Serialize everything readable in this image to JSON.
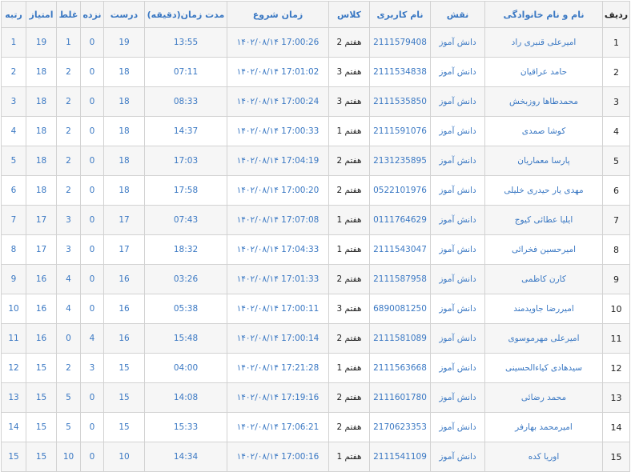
{
  "headers": {
    "radif": "ردیف",
    "name": "نام و نام خانوادگی",
    "role": "نقش",
    "username": "نام کاربری",
    "class": "کلاس",
    "start": "زمان شروع",
    "duration": "مدت زمان(دقیقه)",
    "correct": "درست",
    "unanswered": "نزده",
    "wrong": "غلط",
    "score": "امتیاز",
    "rank": "رتبه"
  },
  "rows": [
    {
      "radif": "1",
      "name": "امیرعلی قنبری راد",
      "role": "دانش آموز",
      "username": "2111579408",
      "class": "هفتم 2",
      "start": "۱۴۰۲/۰۸/۱۴ 17:00:26",
      "duration": "13:55",
      "correct": "19",
      "unanswered": "0",
      "wrong": "1",
      "score": "19",
      "rank": "1"
    },
    {
      "radif": "2",
      "name": "حامد عراقیان",
      "role": "دانش آموز",
      "username": "2111534838",
      "class": "هفتم 3",
      "start": "۱۴۰۲/۰۸/۱۴ 17:01:02",
      "duration": "07:11",
      "correct": "18",
      "unanswered": "0",
      "wrong": "2",
      "score": "18",
      "rank": "2"
    },
    {
      "radif": "3",
      "name": "محمدطاها روزبخش",
      "role": "دانش آموز",
      "username": "2111535850",
      "class": "هفتم 3",
      "start": "۱۴۰۲/۰۸/۱۴ 17:00:24",
      "duration": "08:33",
      "correct": "18",
      "unanswered": "0",
      "wrong": "2",
      "score": "18",
      "rank": "3"
    },
    {
      "radif": "4",
      "name": "کوشا صمدی",
      "role": "دانش آموز",
      "username": "2111591076",
      "class": "هفتم 1",
      "start": "۱۴۰۲/۰۸/۱۴ 17:00:33",
      "duration": "14:37",
      "correct": "18",
      "unanswered": "0",
      "wrong": "2",
      "score": "18",
      "rank": "4"
    },
    {
      "radif": "5",
      "name": "پارسا معماریان",
      "role": "دانش آموز",
      "username": "2131235895",
      "class": "هفتم 2",
      "start": "۱۴۰۲/۰۸/۱۴ 17:04:19",
      "duration": "17:03",
      "correct": "18",
      "unanswered": "0",
      "wrong": "2",
      "score": "18",
      "rank": "5"
    },
    {
      "radif": "6",
      "name": "مهدی یار حیدری خلیلی",
      "role": "دانش آموز",
      "username": "0522101976",
      "class": "هفتم 2",
      "start": "۱۴۰۲/۰۸/۱۴ 17:00:20",
      "duration": "17:58",
      "correct": "18",
      "unanswered": "0",
      "wrong": "2",
      "score": "18",
      "rank": "6"
    },
    {
      "radif": "7",
      "name": "ایلیا عطائی کیوج",
      "role": "دانش آموز",
      "username": "0111764629",
      "class": "هفتم 1",
      "start": "۱۴۰۲/۰۸/۱۴ 17:07:08",
      "duration": "07:43",
      "correct": "17",
      "unanswered": "0",
      "wrong": "3",
      "score": "17",
      "rank": "7"
    },
    {
      "radif": "8",
      "name": "امیرحسین فخرائی",
      "role": "دانش آموز",
      "username": "2111543047",
      "class": "هفتم 1",
      "start": "۱۴۰۲/۰۸/۱۴ 17:04:33",
      "duration": "18:32",
      "correct": "17",
      "unanswered": "0",
      "wrong": "3",
      "score": "17",
      "rank": "8"
    },
    {
      "radif": "9",
      "name": "کارن کاظمی",
      "role": "دانش آموز",
      "username": "2111587958",
      "class": "هفتم 2",
      "start": "۱۴۰۲/۰۸/۱۴ 17:01:33",
      "duration": "03:26",
      "correct": "16",
      "unanswered": "0",
      "wrong": "4",
      "score": "16",
      "rank": "9"
    },
    {
      "radif": "10",
      "name": "امیررضا جاویدمند",
      "role": "دانش آموز",
      "username": "6890081250",
      "class": "هفتم 3",
      "start": "۱۴۰۲/۰۸/۱۴ 17:00:11",
      "duration": "05:38",
      "correct": "16",
      "unanswered": "0",
      "wrong": "4",
      "score": "16",
      "rank": "10"
    },
    {
      "radif": "11",
      "name": "امیرعلی مهرموسوی",
      "role": "دانش آموز",
      "username": "2111581089",
      "class": "هفتم 2",
      "start": "۱۴۰۲/۰۸/۱۴ 17:00:14",
      "duration": "15:48",
      "correct": "16",
      "unanswered": "4",
      "wrong": "0",
      "score": "16",
      "rank": "11"
    },
    {
      "radif": "12",
      "name": "سیدهادی کیاءالحسینی",
      "role": "دانش آموز",
      "username": "2111563668",
      "class": "هفتم 1",
      "start": "۱۴۰۲/۰۸/۱۴ 17:21:28",
      "duration": "04:00",
      "correct": "15",
      "unanswered": "3",
      "wrong": "2",
      "score": "15",
      "rank": "12"
    },
    {
      "radif": "13",
      "name": "محمد رضائی",
      "role": "دانش آموز",
      "username": "2111601780",
      "class": "هفتم 2",
      "start": "۱۴۰۲/۰۸/۱۴ 17:19:16",
      "duration": "14:08",
      "correct": "15",
      "unanswered": "0",
      "wrong": "5",
      "score": "15",
      "rank": "13"
    },
    {
      "radif": "14",
      "name": "امیرمحمد بهارفر",
      "role": "دانش آموز",
      "username": "2170623353",
      "class": "هفتم 2",
      "start": "۱۴۰۲/۰۸/۱۴ 17:06:21",
      "duration": "15:33",
      "correct": "15",
      "unanswered": "0",
      "wrong": "5",
      "score": "15",
      "rank": "14"
    },
    {
      "radif": "15",
      "name": "اوریا کده",
      "role": "دانش آموز",
      "username": "2111541109",
      "class": "هفتم 1",
      "start": "۱۴۰۲/۰۸/۱۴ 17:00:16",
      "duration": "14:34",
      "correct": "10",
      "unanswered": "0",
      "wrong": "10",
      "score": "15",
      "rank": "15"
    }
  ]
}
